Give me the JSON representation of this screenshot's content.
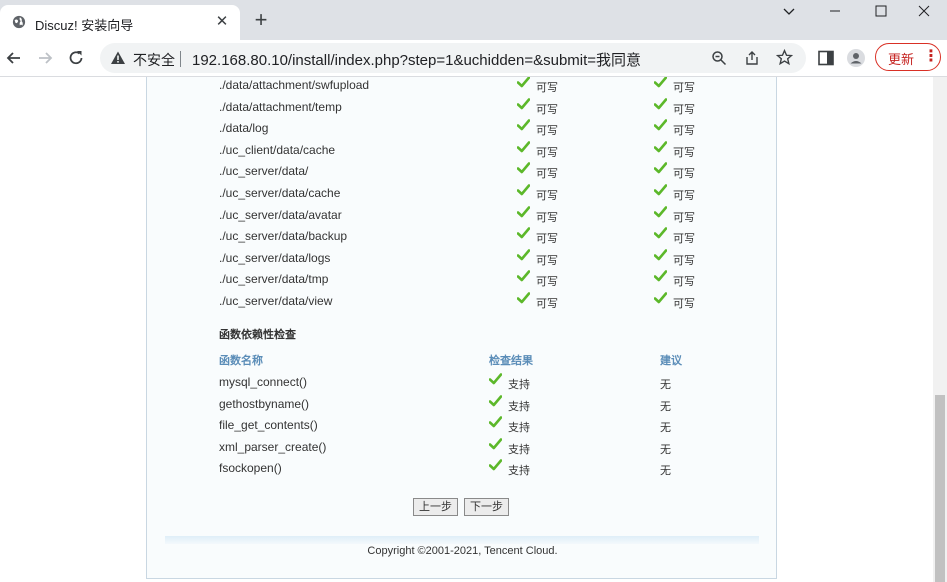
{
  "browser": {
    "tab_title": "Discuz! 安装向导",
    "address": {
      "security_label": "不安全",
      "url": "192.168.80.10/install/index.php?step=1&uchidden=&submit=我同意"
    },
    "update_label": "更新"
  },
  "dirs": [
    {
      "path": "./data/attachment/swfupload",
      "current": "可写",
      "required": "可写"
    },
    {
      "path": "./data/attachment/temp",
      "current": "可写",
      "required": "可写"
    },
    {
      "path": "./data/log",
      "current": "可写",
      "required": "可写"
    },
    {
      "path": "./uc_client/data/cache",
      "current": "可写",
      "required": "可写"
    },
    {
      "path": "./uc_server/data/",
      "current": "可写",
      "required": "可写"
    },
    {
      "path": "./uc_server/data/cache",
      "current": "可写",
      "required": "可写"
    },
    {
      "path": "./uc_server/data/avatar",
      "current": "可写",
      "required": "可写"
    },
    {
      "path": "./uc_server/data/backup",
      "current": "可写",
      "required": "可写"
    },
    {
      "path": "./uc_server/data/logs",
      "current": "可写",
      "required": "可写"
    },
    {
      "path": "./uc_server/data/tmp",
      "current": "可写",
      "required": "可写"
    },
    {
      "path": "./uc_server/data/view",
      "current": "可写",
      "required": "可写"
    }
  ],
  "func_section": {
    "title": "函数依赖性检查",
    "headers": {
      "name": "函数名称",
      "result": "检查结果",
      "advice": "建议"
    },
    "rows": [
      {
        "name": "mysql_connect()",
        "result": "支持",
        "advice": "无"
      },
      {
        "name": "gethostbyname()",
        "result": "支持",
        "advice": "无"
      },
      {
        "name": "file_get_contents()",
        "result": "支持",
        "advice": "无"
      },
      {
        "name": "xml_parser_create()",
        "result": "支持",
        "advice": "无"
      },
      {
        "name": "fsockopen()",
        "result": "支持",
        "advice": "无"
      }
    ]
  },
  "buttons": {
    "prev": "上一步",
    "next": "下一步"
  },
  "footer": {
    "copyright": "Copyright ©2001-2021, Tencent Cloud."
  },
  "colors": {
    "check": "#5cb82a",
    "header_text": "#5b8db8",
    "update": "#c5221f"
  }
}
